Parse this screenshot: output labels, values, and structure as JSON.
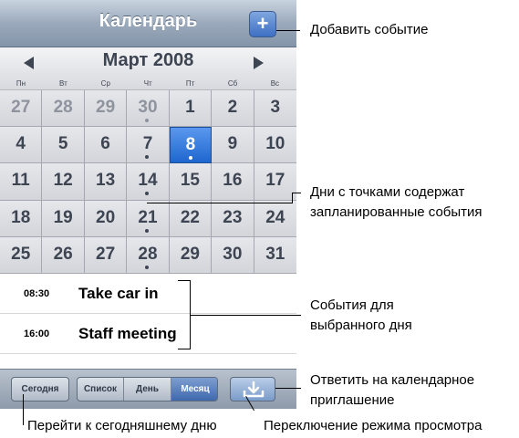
{
  "header": {
    "title": "Календарь",
    "add_label": "+"
  },
  "month": {
    "title": "Март 2008",
    "weekdays": [
      "Пн",
      "Вт",
      "Ср",
      "Чт",
      "Пт",
      "Сб",
      "Вс"
    ]
  },
  "days": [
    [
      {
        "n": "27",
        "out": true
      },
      {
        "n": "28",
        "out": true
      },
      {
        "n": "29",
        "out": true
      },
      {
        "n": "30",
        "out": true,
        "dot": true
      },
      {
        "n": "1"
      },
      {
        "n": "2"
      },
      {
        "n": "3"
      }
    ],
    [
      {
        "n": "4"
      },
      {
        "n": "5"
      },
      {
        "n": "6"
      },
      {
        "n": "7",
        "dot": true
      },
      {
        "n": "8",
        "sel": true,
        "dot": true
      },
      {
        "n": "9"
      },
      {
        "n": "10"
      }
    ],
    [
      {
        "n": "11"
      },
      {
        "n": "12"
      },
      {
        "n": "13"
      },
      {
        "n": "14",
        "dot": true
      },
      {
        "n": "15"
      },
      {
        "n": "16"
      },
      {
        "n": "17"
      }
    ],
    [
      {
        "n": "18"
      },
      {
        "n": "19"
      },
      {
        "n": "20"
      },
      {
        "n": "21",
        "dot": true
      },
      {
        "n": "22"
      },
      {
        "n": "23"
      },
      {
        "n": "24"
      }
    ],
    [
      {
        "n": "25"
      },
      {
        "n": "26"
      },
      {
        "n": "27"
      },
      {
        "n": "28",
        "dot": true
      },
      {
        "n": "29"
      },
      {
        "n": "30"
      },
      {
        "n": "31"
      }
    ]
  ],
  "events": [
    {
      "time": "08:30",
      "title": "Take car in"
    },
    {
      "time": "16:00",
      "title": "Staff meeting"
    }
  ],
  "toolbar": {
    "today": "Сегодня",
    "list": "Список",
    "day": "День",
    "month": "Месяц"
  },
  "annotations": {
    "add_event": "Добавить событие",
    "dots_line1": "Дни с точками содержат",
    "dots_line2": "запланированные события",
    "events_line1": "События для",
    "events_line2": "выбранного дня",
    "reply_line1": "Ответить на календарное",
    "reply_line2": "приглашение",
    "goto_today": "Перейти к сегодняшнему дню",
    "switch_view": "Переключение режима просмотра"
  },
  "colors": {
    "selected": "#1e66cf",
    "titlebar": "#8595a9",
    "text": "#3e4552"
  }
}
